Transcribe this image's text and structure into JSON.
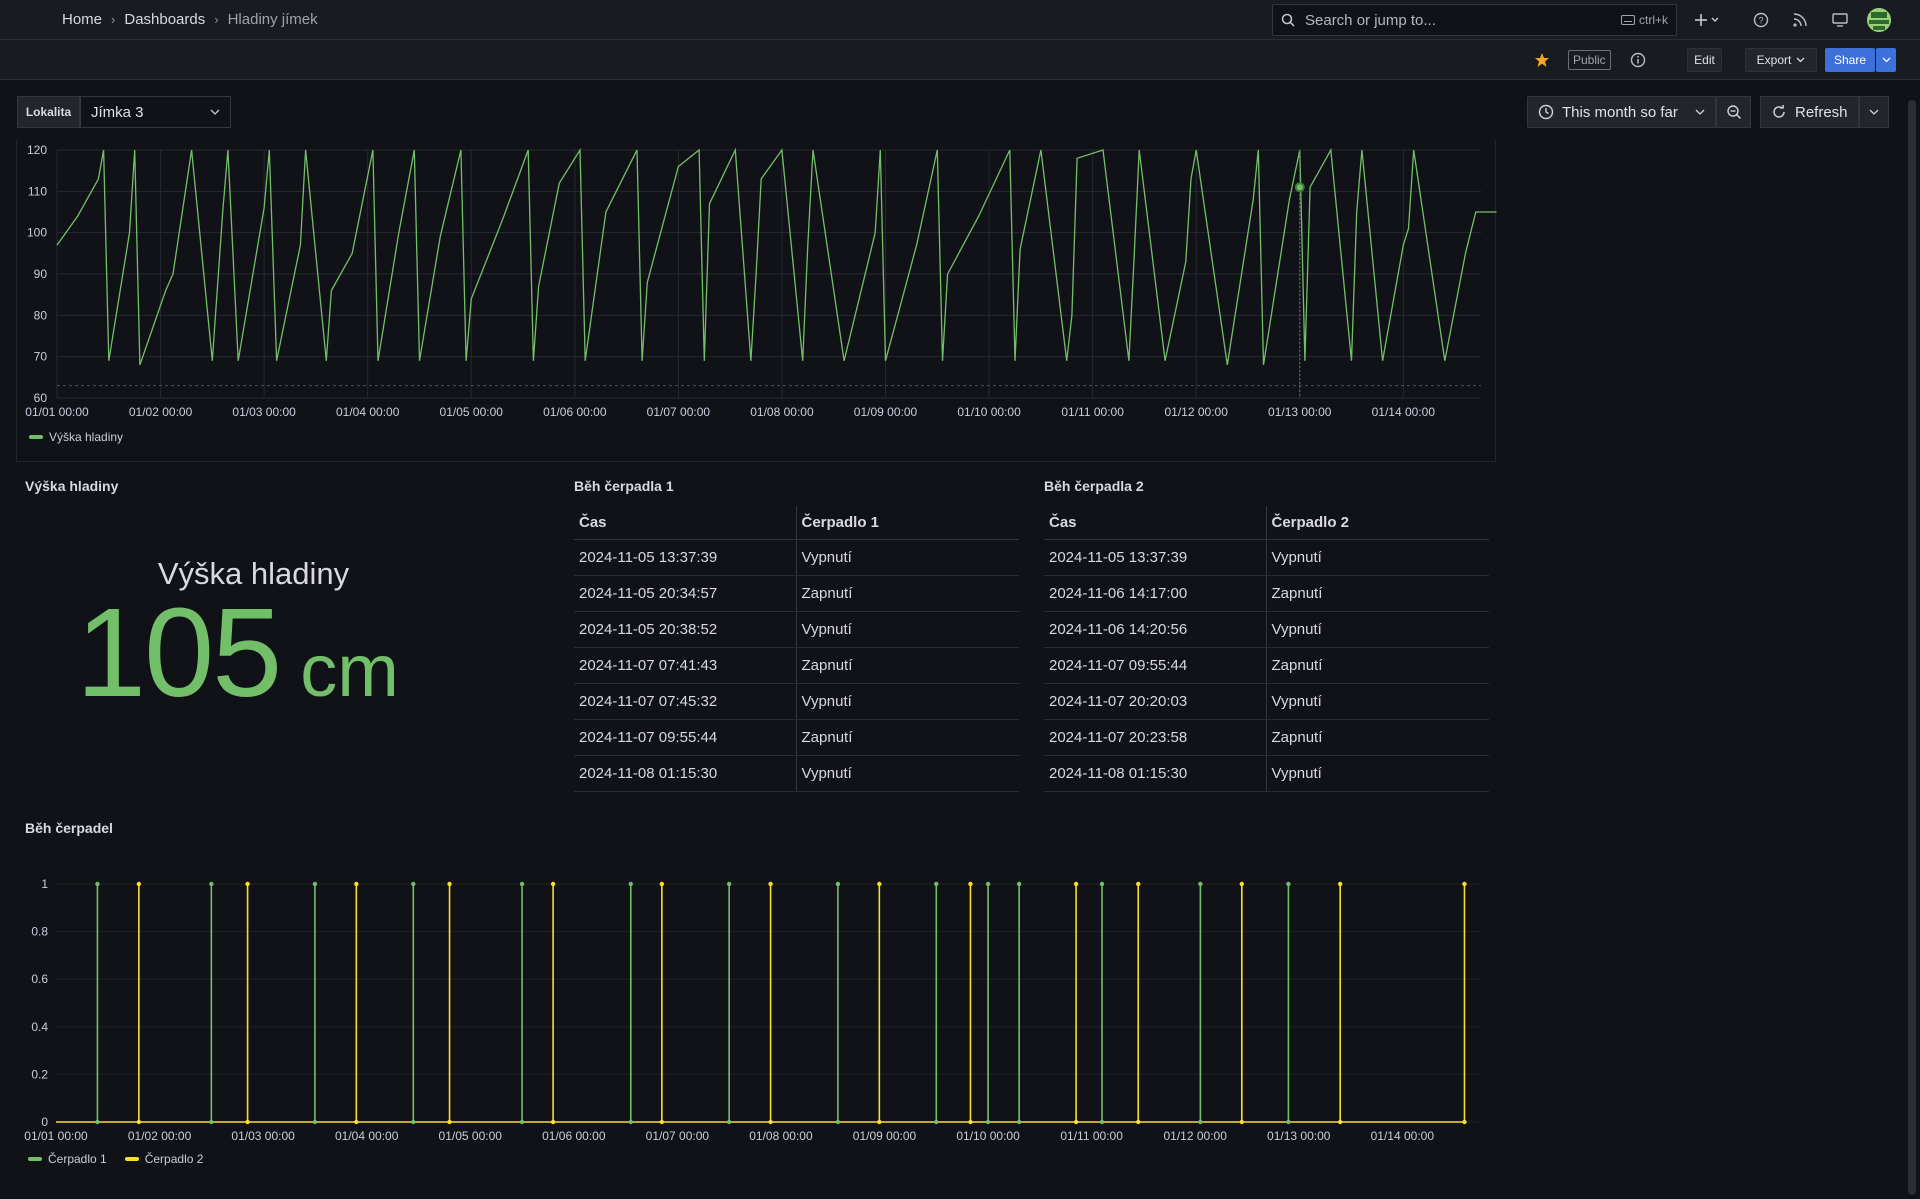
{
  "breadcrumb": [
    "Home",
    "Dashboards",
    "Hladiny jímek"
  ],
  "search": {
    "placeholder": "Search or jump to...",
    "shortcut": "ctrl+k"
  },
  "toolbar": {
    "public_label": "Public",
    "edit_label": "Edit",
    "export_label": "Export",
    "share_label": "Share"
  },
  "variable": {
    "label": "Lokalita",
    "value": "Jímka 3"
  },
  "time": {
    "range_label": "This month so far",
    "refresh_label": "Refresh"
  },
  "colors": {
    "green": "#73bf69",
    "yellow": "#fade2a",
    "accent": "#3d71d9"
  },
  "level_chart": {
    "type": "line",
    "ylim": [
      60,
      120
    ],
    "yticks": [
      60,
      70,
      80,
      90,
      100,
      110,
      120
    ],
    "xticks": [
      "01/01 00:00",
      "01/02 00:00",
      "01/03 00:00",
      "01/04 00:00",
      "01/05 00:00",
      "01/06 00:00",
      "01/07 00:00",
      "01/08 00:00",
      "01/09 00:00",
      "01/10 00:00",
      "01/11 00:00",
      "01/12 00:00",
      "01/13 00:00",
      "01/14 00:00"
    ],
    "threshold": 63,
    "series": [
      {
        "name": "Výška hladiny",
        "color": "#73bf69",
        "x": [
          0,
          0.2,
          0.4,
          0.45,
          0.5,
          0.7,
          0.75,
          0.8,
          1.05,
          1.12,
          1.3,
          1.5,
          1.6,
          1.65,
          1.75,
          2.0,
          2.05,
          2.12,
          2.35,
          2.4,
          2.6,
          2.65,
          2.85,
          3.05,
          3.1,
          3.3,
          3.45,
          3.5,
          3.7,
          3.9,
          3.95,
          4.0,
          4.3,
          4.55,
          4.6,
          4.65,
          4.85,
          5.05,
          5.1,
          5.3,
          5.6,
          5.65,
          5.7,
          6.0,
          6.2,
          6.25,
          6.3,
          6.55,
          6.7,
          6.75,
          6.8,
          7.0,
          7.2,
          7.25,
          7.3,
          7.6,
          7.9,
          7.95,
          8.0,
          8.3,
          8.5,
          8.55,
          8.6,
          8.9,
          9.2,
          9.25,
          9.3,
          9.5,
          9.75,
          9.8,
          9.85,
          10.1,
          10.35,
          10.4,
          10.45,
          10.7,
          10.9,
          10.95,
          11.0,
          11.3,
          11.55,
          11.6,
          11.65,
          11.9,
          12.0,
          12.05,
          12.1,
          12.3,
          12.5,
          12.55,
          12.6,
          12.8,
          13.0,
          13.05,
          13.1,
          13.4,
          13.6,
          13.65,
          13.7,
          13.9
        ],
        "y": [
          97,
          104,
          113,
          120,
          69,
          100,
          120,
          68,
          86,
          90,
          120,
          69,
          105,
          120,
          69,
          106,
          120,
          69,
          97,
          120,
          69,
          86,
          95,
          120,
          69,
          100,
          120,
          69,
          99,
          120,
          69,
          84,
          103,
          120,
          69,
          87,
          112,
          120,
          69,
          105,
          120,
          69,
          88,
          116,
          120,
          69,
          107,
          120,
          69,
          90,
          113,
          120,
          69,
          97,
          120,
          69,
          100,
          120,
          69,
          97,
          120,
          69,
          90,
          104,
          120,
          69,
          96,
          120,
          69,
          80,
          118,
          120,
          69,
          94,
          120,
          69,
          93,
          113,
          120,
          68,
          108,
          120,
          68,
          108,
          120,
          69,
          111,
          120,
          69,
          105,
          120,
          69,
          97,
          101,
          120,
          69,
          95,
          100,
          105,
          105
        ]
      }
    ],
    "legend_label": "Výška hladiny"
  },
  "stat": {
    "title": "Výška hladiny",
    "value": "105",
    "unit": "cm"
  },
  "pump1_table": {
    "title": "Běh čerpadla 1",
    "columns": [
      "Čas",
      "Čerpadlo 1"
    ],
    "rows": [
      [
        "2024-11-05 13:37:39",
        "Vypnutí"
      ],
      [
        "2024-11-05 20:34:57",
        "Zapnutí"
      ],
      [
        "2024-11-05 20:38:52",
        "Vypnutí"
      ],
      [
        "2024-11-07 07:41:43",
        "Zapnutí"
      ],
      [
        "2024-11-07 07:45:32",
        "Vypnutí"
      ],
      [
        "2024-11-07 09:55:44",
        "Zapnutí"
      ],
      [
        "2024-11-08 01:15:30",
        "Vypnutí"
      ]
    ]
  },
  "pump2_table": {
    "title": "Běh čerpadla 2",
    "columns": [
      "Čas",
      "Čerpadlo 2"
    ],
    "rows": [
      [
        "2024-11-05 13:37:39",
        "Vypnutí"
      ],
      [
        "2024-11-06 14:17:00",
        "Zapnutí"
      ],
      [
        "2024-11-06 14:20:56",
        "Vypnutí"
      ],
      [
        "2024-11-07 09:55:44",
        "Zapnutí"
      ],
      [
        "2024-11-07 20:20:03",
        "Vypnutí"
      ],
      [
        "2024-11-07 20:23:58",
        "Zapnutí"
      ],
      [
        "2024-11-08 01:15:30",
        "Vypnutí"
      ]
    ]
  },
  "chart_data": {
    "type": "line",
    "title": "Běh čerpadel",
    "ylim": [
      0,
      1
    ],
    "yticks": [
      "0",
      "0.2",
      "0.4",
      "0.6",
      "0.8",
      "1"
    ],
    "xticks": [
      "01/01 00:00",
      "01/02 00:00",
      "01/03 00:00",
      "01/04 00:00",
      "01/05 00:00",
      "01/06 00:00",
      "01/07 00:00",
      "01/08 00:00",
      "01/09 00:00",
      "01/10 00:00",
      "01/11 00:00",
      "01/12 00:00",
      "01/13 00:00",
      "01/14 00:00"
    ],
    "series": [
      {
        "name": "Čerpadlo 1",
        "color": "#73bf69",
        "pulses": [
          0.4,
          1.5,
          2.5,
          3.45,
          4.5,
          5.55,
          6.5,
          7.55,
          8.5,
          9.0,
          9.3,
          10.1,
          11.05,
          11.9
        ]
      },
      {
        "name": "Čerpadlo 2",
        "color": "#fade2a",
        "pulses": [
          0.8,
          1.85,
          2.9,
          3.8,
          4.8,
          5.85,
          6.9,
          7.95,
          8.83,
          9.85,
          10.45,
          11.45,
          12.4,
          13.6
        ]
      }
    ]
  }
}
